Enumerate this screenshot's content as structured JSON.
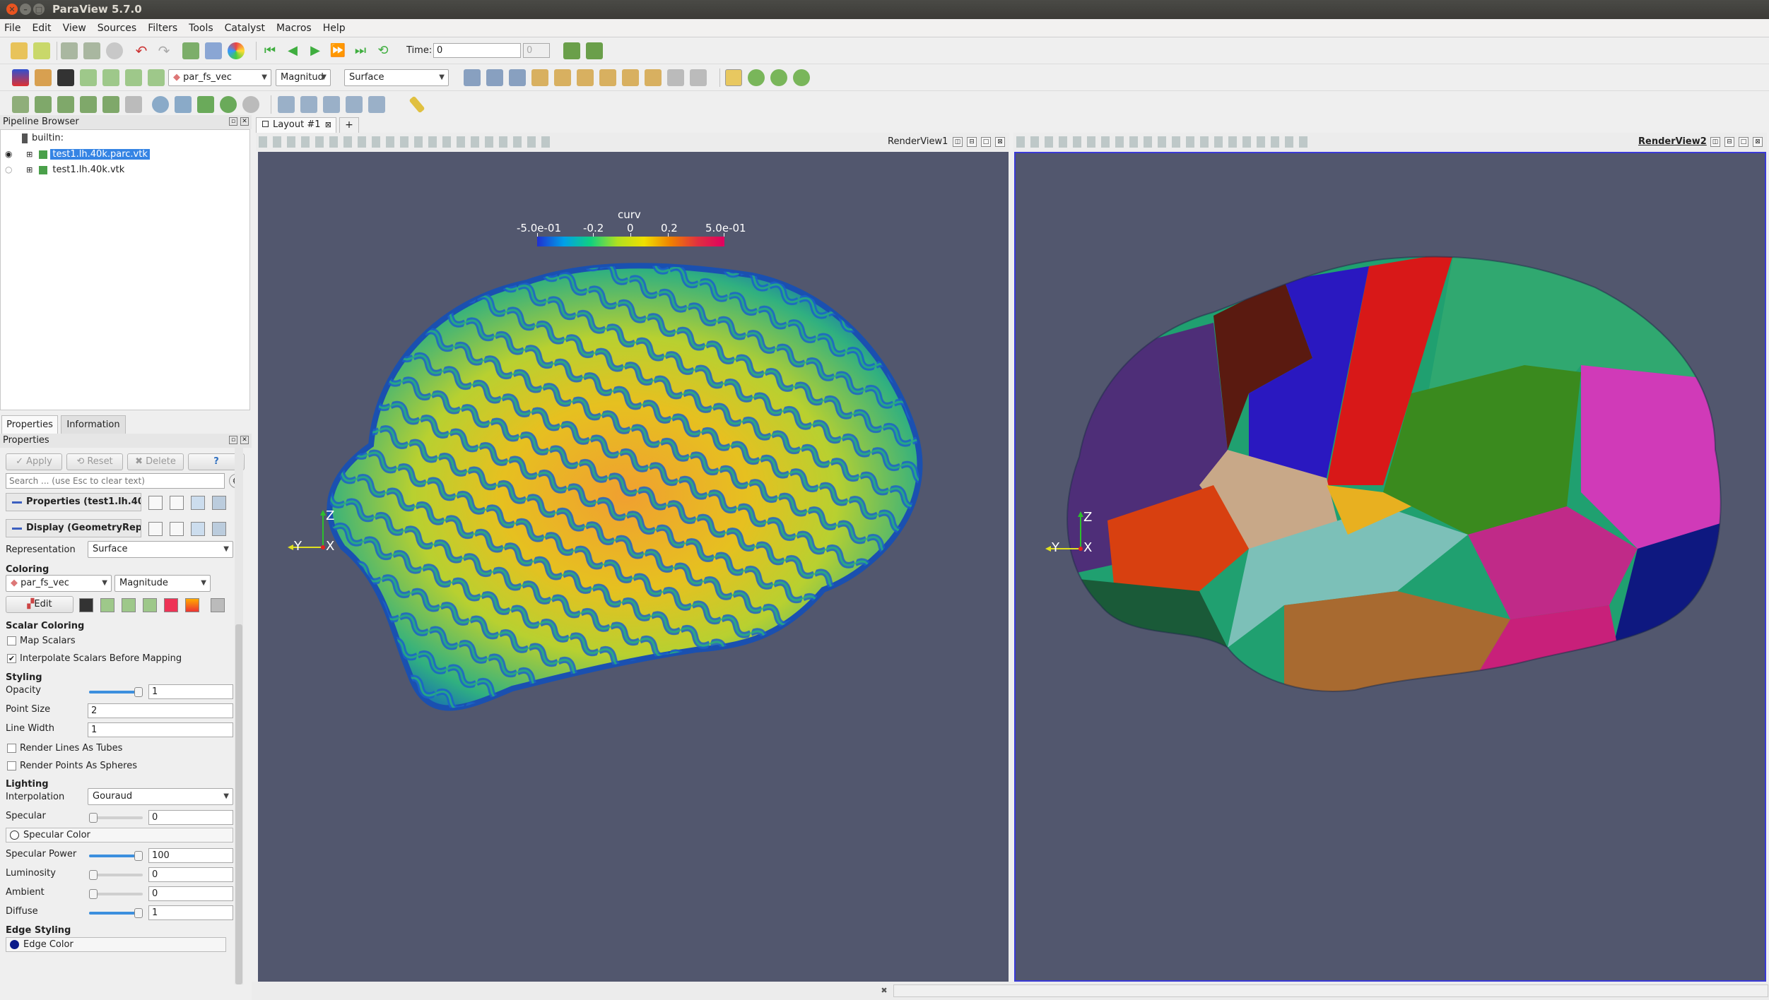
{
  "window": {
    "title": "ParaView 5.7.0"
  },
  "menu": [
    "File",
    "Edit",
    "View",
    "Sources",
    "Filters",
    "Tools",
    "Catalyst",
    "Macros",
    "Help"
  ],
  "toolbar": {
    "time_label": "Time:",
    "time_value": "0",
    "time_step": "0",
    "color_array": "par_fs_vec",
    "component": "Magnitud",
    "representation": "Surface"
  },
  "pipeline": {
    "title": "Pipeline Browser",
    "root": "builtin:",
    "items": [
      {
        "label": "test1.lh.40k.parc.vtk",
        "selected": true,
        "visible": true
      },
      {
        "label": "test1.lh.40k.vtk",
        "selected": false,
        "visible": false
      }
    ]
  },
  "tabs": {
    "properties": "Properties",
    "information": "Information"
  },
  "properties": {
    "title": "Properties",
    "apply": "Apply",
    "reset": "Reset",
    "delete": "Delete",
    "help": "?",
    "search_placeholder": "Search ... (use Esc to clear text)",
    "group_properties": "Properties (test1.lh.40",
    "group_display": "Display (GeometryRep",
    "representation_label": "Representation",
    "representation_value": "Surface",
    "coloring": "Coloring",
    "color_array": "par_fs_vec",
    "component": "Magnitude",
    "edit": "Edit",
    "scalar_coloring": "Scalar Coloring",
    "map_scalars": "Map Scalars",
    "interpolate": "Interpolate Scalars Before Mapping",
    "styling": "Styling",
    "opacity_label": "Opacity",
    "opacity": "1",
    "opacity_level": 1.0,
    "point_size_label": "Point Size",
    "point_size": "2",
    "line_width_label": "Line Width",
    "line_width": "1",
    "render_lines": "Render Lines As Tubes",
    "render_points": "Render Points As Spheres",
    "lighting": "Lighting",
    "interpolation_label": "Interpolation",
    "interpolation": "Gouraud",
    "specular_label": "Specular",
    "specular": "0",
    "specular_level": 0,
    "specular_color": "Specular Color",
    "specular_power_label": "Specular Power",
    "specular_power": "100",
    "specular_power_level": 1.0,
    "luminosity_label": "Luminosity",
    "luminosity": "0",
    "luminosity_level": 0,
    "ambient_label": "Ambient",
    "ambient": "0",
    "ambient_level": 0,
    "diffuse_label": "Diffuse",
    "diffuse": "1",
    "diffuse_level": 1.0,
    "edge_styling": "Edge Styling",
    "edge_color": "Edge Color"
  },
  "layout": {
    "tab": "Layout #1",
    "add": "+"
  },
  "views": [
    {
      "name": "RenderView1",
      "active": false,
      "threed": "3D"
    },
    {
      "name": "RenderView2",
      "active": true,
      "threed": "3D"
    }
  ],
  "colorbar": {
    "title": "curv",
    "ticks": [
      "-5.0e-01",
      "-0.2",
      "0",
      "0.2",
      "5.0e-01"
    ]
  },
  "axes": {
    "z": "Z",
    "y": "Y",
    "x": "X"
  },
  "colors": {
    "view_bg": "#52576e",
    "selection": "#3584e4",
    "active_border": "#3a3ad6"
  }
}
